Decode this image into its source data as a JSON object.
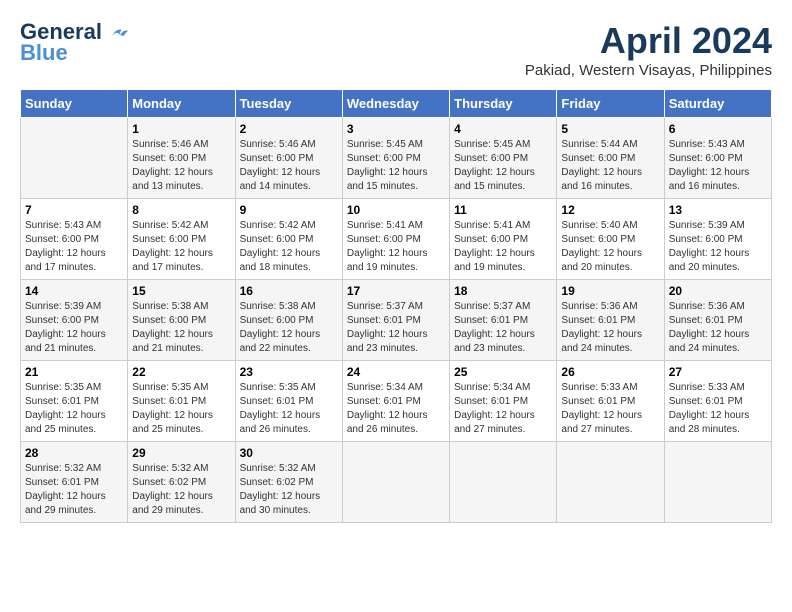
{
  "header": {
    "logo_line1": "General",
    "logo_line2": "Blue",
    "month_title": "April 2024",
    "location": "Pakiad, Western Visayas, Philippines"
  },
  "calendar": {
    "days_of_week": [
      "Sunday",
      "Monday",
      "Tuesday",
      "Wednesday",
      "Thursday",
      "Friday",
      "Saturday"
    ],
    "weeks": [
      [
        {
          "day": "",
          "info": ""
        },
        {
          "day": "1",
          "info": "Sunrise: 5:46 AM\nSunset: 6:00 PM\nDaylight: 12 hours\nand 13 minutes."
        },
        {
          "day": "2",
          "info": "Sunrise: 5:46 AM\nSunset: 6:00 PM\nDaylight: 12 hours\nand 14 minutes."
        },
        {
          "day": "3",
          "info": "Sunrise: 5:45 AM\nSunset: 6:00 PM\nDaylight: 12 hours\nand 15 minutes."
        },
        {
          "day": "4",
          "info": "Sunrise: 5:45 AM\nSunset: 6:00 PM\nDaylight: 12 hours\nand 15 minutes."
        },
        {
          "day": "5",
          "info": "Sunrise: 5:44 AM\nSunset: 6:00 PM\nDaylight: 12 hours\nand 16 minutes."
        },
        {
          "day": "6",
          "info": "Sunrise: 5:43 AM\nSunset: 6:00 PM\nDaylight: 12 hours\nand 16 minutes."
        }
      ],
      [
        {
          "day": "7",
          "info": "Sunrise: 5:43 AM\nSunset: 6:00 PM\nDaylight: 12 hours\nand 17 minutes."
        },
        {
          "day": "8",
          "info": "Sunrise: 5:42 AM\nSunset: 6:00 PM\nDaylight: 12 hours\nand 17 minutes."
        },
        {
          "day": "9",
          "info": "Sunrise: 5:42 AM\nSunset: 6:00 PM\nDaylight: 12 hours\nand 18 minutes."
        },
        {
          "day": "10",
          "info": "Sunrise: 5:41 AM\nSunset: 6:00 PM\nDaylight: 12 hours\nand 19 minutes."
        },
        {
          "day": "11",
          "info": "Sunrise: 5:41 AM\nSunset: 6:00 PM\nDaylight: 12 hours\nand 19 minutes."
        },
        {
          "day": "12",
          "info": "Sunrise: 5:40 AM\nSunset: 6:00 PM\nDaylight: 12 hours\nand 20 minutes."
        },
        {
          "day": "13",
          "info": "Sunrise: 5:39 AM\nSunset: 6:00 PM\nDaylight: 12 hours\nand 20 minutes."
        }
      ],
      [
        {
          "day": "14",
          "info": "Sunrise: 5:39 AM\nSunset: 6:00 PM\nDaylight: 12 hours\nand 21 minutes."
        },
        {
          "day": "15",
          "info": "Sunrise: 5:38 AM\nSunset: 6:00 PM\nDaylight: 12 hours\nand 21 minutes."
        },
        {
          "day": "16",
          "info": "Sunrise: 5:38 AM\nSunset: 6:00 PM\nDaylight: 12 hours\nand 22 minutes."
        },
        {
          "day": "17",
          "info": "Sunrise: 5:37 AM\nSunset: 6:01 PM\nDaylight: 12 hours\nand 23 minutes."
        },
        {
          "day": "18",
          "info": "Sunrise: 5:37 AM\nSunset: 6:01 PM\nDaylight: 12 hours\nand 23 minutes."
        },
        {
          "day": "19",
          "info": "Sunrise: 5:36 AM\nSunset: 6:01 PM\nDaylight: 12 hours\nand 24 minutes."
        },
        {
          "day": "20",
          "info": "Sunrise: 5:36 AM\nSunset: 6:01 PM\nDaylight: 12 hours\nand 24 minutes."
        }
      ],
      [
        {
          "day": "21",
          "info": "Sunrise: 5:35 AM\nSunset: 6:01 PM\nDaylight: 12 hours\nand 25 minutes."
        },
        {
          "day": "22",
          "info": "Sunrise: 5:35 AM\nSunset: 6:01 PM\nDaylight: 12 hours\nand 25 minutes."
        },
        {
          "day": "23",
          "info": "Sunrise: 5:35 AM\nSunset: 6:01 PM\nDaylight: 12 hours\nand 26 minutes."
        },
        {
          "day": "24",
          "info": "Sunrise: 5:34 AM\nSunset: 6:01 PM\nDaylight: 12 hours\nand 26 minutes."
        },
        {
          "day": "25",
          "info": "Sunrise: 5:34 AM\nSunset: 6:01 PM\nDaylight: 12 hours\nand 27 minutes."
        },
        {
          "day": "26",
          "info": "Sunrise: 5:33 AM\nSunset: 6:01 PM\nDaylight: 12 hours\nand 27 minutes."
        },
        {
          "day": "27",
          "info": "Sunrise: 5:33 AM\nSunset: 6:01 PM\nDaylight: 12 hours\nand 28 minutes."
        }
      ],
      [
        {
          "day": "28",
          "info": "Sunrise: 5:32 AM\nSunset: 6:01 PM\nDaylight: 12 hours\nand 29 minutes."
        },
        {
          "day": "29",
          "info": "Sunrise: 5:32 AM\nSunset: 6:02 PM\nDaylight: 12 hours\nand 29 minutes."
        },
        {
          "day": "30",
          "info": "Sunrise: 5:32 AM\nSunset: 6:02 PM\nDaylight: 12 hours\nand 30 minutes."
        },
        {
          "day": "",
          "info": ""
        },
        {
          "day": "",
          "info": ""
        },
        {
          "day": "",
          "info": ""
        },
        {
          "day": "",
          "info": ""
        }
      ]
    ]
  }
}
